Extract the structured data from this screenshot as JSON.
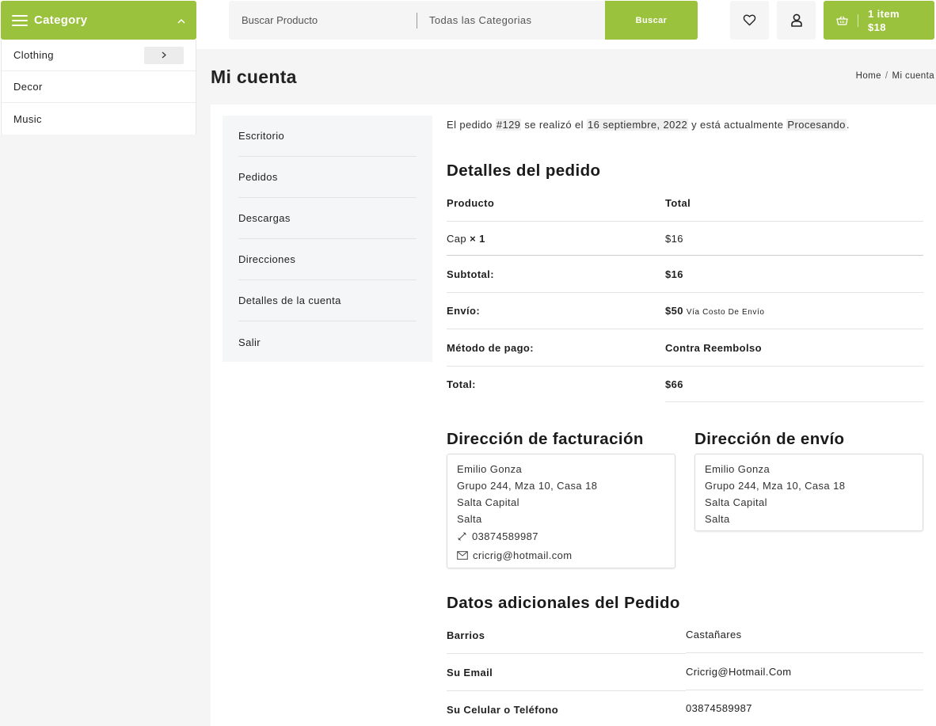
{
  "category_menu": {
    "title": "Category",
    "items": [
      {
        "label": "Clothing",
        "has_submenu": true
      },
      {
        "label": "Decor",
        "has_submenu": false
      },
      {
        "label": "Music",
        "has_submenu": false
      }
    ]
  },
  "search": {
    "placeholder": "Buscar Producto",
    "category_select": "Todas las Categorias",
    "button_label": "Buscar"
  },
  "header_icons": [
    "heart-icon",
    "user-icon"
  ],
  "cart": {
    "count_label": "1 item",
    "total": "$18"
  },
  "page": {
    "title": "Mi cuenta",
    "breadcrumb": [
      "Home",
      "Mi cuenta"
    ]
  },
  "account_nav": [
    "Escritorio",
    "Pedidos",
    "Descargas",
    "Direcciones",
    "Detalles de la cuenta",
    "Salir"
  ],
  "order_notice": {
    "prefix": "El pedido ",
    "order_number": "#129",
    "mid": " se realizó el ",
    "date": "16 septiembre, 2022",
    "mid2": " y está actualmente ",
    "status": "Procesando",
    "suffix": "."
  },
  "order_details": {
    "heading": "Detalles del pedido",
    "col_product": "Producto",
    "col_total": "Total",
    "items": [
      {
        "name": "Cap",
        "qty": "× 1",
        "total": "$16"
      }
    ],
    "summary": [
      {
        "label": "Subtotal:",
        "value": "$16",
        "note": ""
      },
      {
        "label": "Envío:",
        "value": "$50",
        "note": "Vía Costo De Envío"
      },
      {
        "label": "Método de pago:",
        "value": "Contra Reembolso",
        "note": ""
      },
      {
        "label": "Total:",
        "value": "$66",
        "note": ""
      }
    ]
  },
  "billing": {
    "heading": "Dirección de facturación",
    "name": "Emilio Gonza",
    "address": "Grupo 244, Mza 10, Casa 18",
    "city": "Salta Capital",
    "state": "Salta",
    "phone": "03874589987",
    "email": "cricrig@hotmail.com"
  },
  "shipping": {
    "heading": "Dirección de envío",
    "name": "Emilio Gonza",
    "address": "Grupo 244, Mza 10, Casa 18",
    "city": "Salta Capital",
    "state": "Salta"
  },
  "additional": {
    "heading": "Datos adicionales del Pedido",
    "rows": [
      {
        "label": "Barrios",
        "value": "Castañares"
      },
      {
        "label": "Su Email",
        "value": "Cricrig@Hotmail.Com"
      },
      {
        "label": "Su Celular o Teléfono",
        "value": "03874589987"
      }
    ]
  },
  "colors": {
    "accent": "#9bc23c",
    "panel_bg": "#f5f5f5",
    "text": "#1f1f1f"
  }
}
